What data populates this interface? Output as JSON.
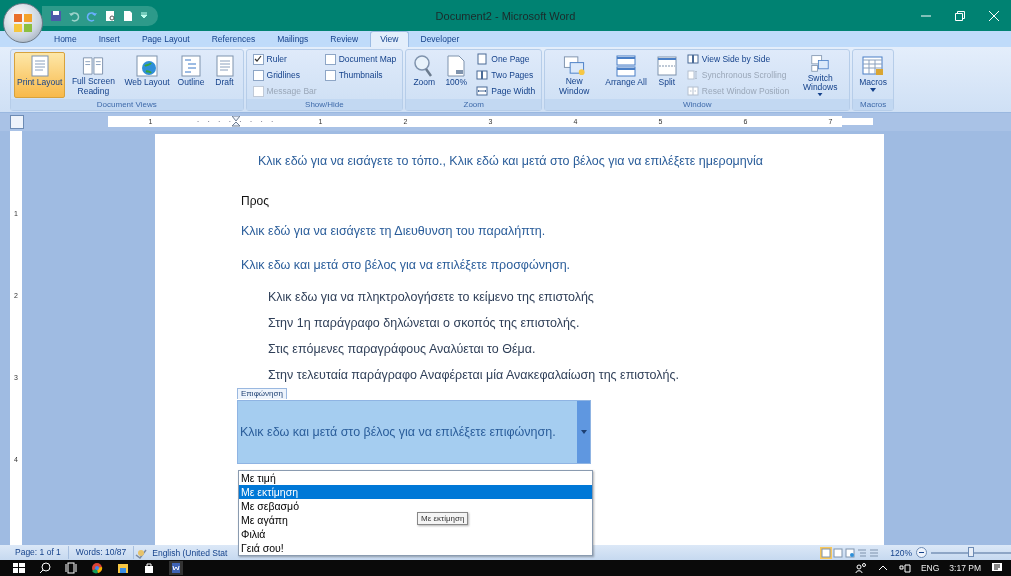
{
  "window": {
    "title": "Document2 - Microsoft Word"
  },
  "tabs": [
    {
      "label": "Home",
      "selected": false
    },
    {
      "label": "Insert",
      "selected": false
    },
    {
      "label": "Page Layout",
      "selected": false
    },
    {
      "label": "References",
      "selected": false
    },
    {
      "label": "Mailings",
      "selected": false
    },
    {
      "label": "Review",
      "selected": false
    },
    {
      "label": "View",
      "selected": true
    },
    {
      "label": "Developer",
      "selected": false
    }
  ],
  "ribbon": [
    {
      "label": "Document Views",
      "items": [
        {
          "kind": "big",
          "label": "Print Layout",
          "selected": true
        },
        {
          "kind": "big",
          "label": "Full Screen Reading",
          "selected": false
        },
        {
          "kind": "big",
          "label": "Web Layout",
          "selected": false
        },
        {
          "kind": "big",
          "label": "Outline",
          "selected": false
        },
        {
          "kind": "big",
          "label": "Draft",
          "selected": false
        }
      ]
    },
    {
      "label": "Show/Hide",
      "items": [
        {
          "kind": "check",
          "label": "Ruler",
          "checked": true,
          "disabled": false
        },
        {
          "kind": "check",
          "label": "Gridlines",
          "checked": false,
          "disabled": false
        },
        {
          "kind": "check",
          "label": "Message Bar",
          "checked": false,
          "disabled": true
        },
        {
          "kind": "check",
          "label": "Document Map",
          "checked": false,
          "disabled": false
        },
        {
          "kind": "check",
          "label": "Thumbnails",
          "checked": false,
          "disabled": false
        }
      ]
    },
    {
      "label": "Zoom",
      "items": [
        {
          "kind": "big",
          "label": "Zoom",
          "selected": false
        },
        {
          "kind": "big",
          "label": "100%",
          "selected": false
        },
        {
          "kind": "small",
          "label": "One Page",
          "disabled": false
        },
        {
          "kind": "small",
          "label": "Two Pages",
          "disabled": false
        },
        {
          "kind": "small",
          "label": "Page Width",
          "disabled": false
        }
      ]
    },
    {
      "label": "Window",
      "items": [
        {
          "kind": "big",
          "label": "New Window",
          "selected": false
        },
        {
          "kind": "big",
          "label": "Arrange All",
          "selected": false
        },
        {
          "kind": "big",
          "label": "Split",
          "selected": false
        },
        {
          "kind": "small",
          "label": "View Side by Side",
          "disabled": false
        },
        {
          "kind": "small",
          "label": "Synchronous Scrolling",
          "disabled": true
        },
        {
          "kind": "small",
          "label": "Reset Window Position",
          "disabled": true
        },
        {
          "kind": "big",
          "label": "Switch Windows",
          "selected": false,
          "menu": true
        }
      ]
    },
    {
      "label": "Macros",
      "items": [
        {
          "kind": "big",
          "label": "Macros",
          "selected": false,
          "menu": true
        }
      ]
    }
  ],
  "ruler": [
    "1",
    "1",
    "2",
    "3",
    "4",
    "5",
    "6",
    "7"
  ],
  "vertical_ruler": [
    "1",
    "2",
    "3",
    "4"
  ],
  "document": {
    "header": "Κλικ εδώ για να εισάγετε το τόπο.,  Κλικ εδώ και μετά στο βέλος για να επιλέξετε ημερομηνία",
    "recipient_label": "Προς",
    "lines": [
      "Κλικ εδώ για να εισάγετε τη Διευθυνση του παραλήπτη.",
      "Κλικ εδω και μετά στο βέλος για να επιλέξετε προσφώνηση."
    ],
    "paragraphs": [
      "Κλικ εδω για να πληκτρολογήσετε το κείμενο της επιστολής",
      "Στην 1η παράγραφο δηλώνεται ο σκοπός της επιστολής.",
      "Στις επόμενες παραγράφους Αναλύεται το Θέμα.",
      "Στην τελευταία παράγραφο Αναφέρεται μία Ανακεφαλαίωση της επιστολής."
    ],
    "content_control": {
      "tag": "Επιφώνηση",
      "text": "Κλικ εδω και μετά στο βέλος για να επιλέξετε επιφώνηση.",
      "options": [
        {
          "label": "Με τιμή",
          "selected": false
        },
        {
          "label": "Με εκτίμηση",
          "selected": true
        },
        {
          "label": "Με σεβασμό",
          "selected": false
        },
        {
          "label": "Με αγάπη",
          "selected": false
        },
        {
          "label": "Φιλιά",
          "selected": false
        },
        {
          "label": "Γειά σου!",
          "selected": false
        }
      ],
      "tooltip": "Με εκτίμηση"
    }
  },
  "status_bar": {
    "page": "Page: 1 of 1",
    "words": "Words: 10/87",
    "language": "English (United Stat",
    "zoom": "120%",
    "zoom_slider": {
      "level": 0.5
    }
  },
  "taskbar": {
    "language": "ENG",
    "time": "3:17 PM"
  }
}
